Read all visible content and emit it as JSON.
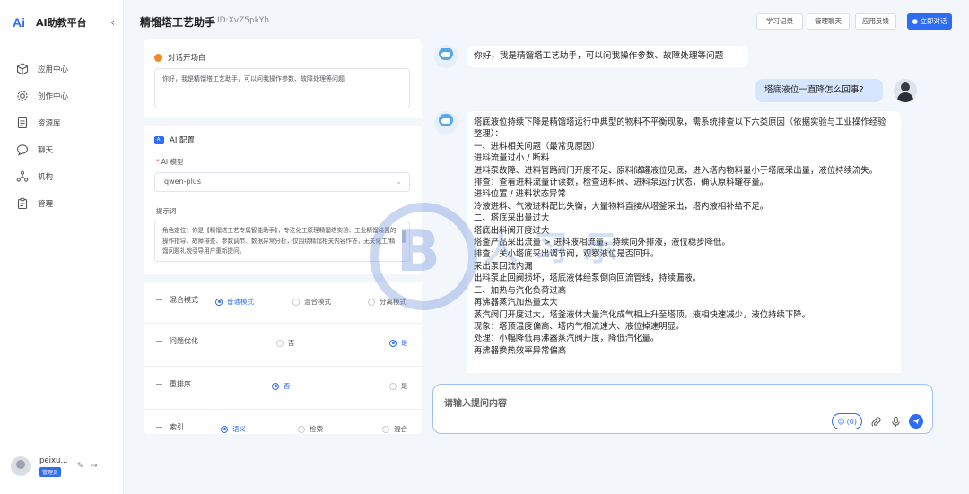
{
  "sidebar": {
    "brand_logo": "Ai",
    "brand_title": "AI助教平台",
    "collapse_icon": "chevron-left-icon",
    "items": [
      {
        "label": "应用中心",
        "icon": "cube-icon"
      },
      {
        "label": "创作中心",
        "icon": "gear-icon"
      },
      {
        "label": "资源库",
        "icon": "document-icon"
      },
      {
        "label": "聊天",
        "icon": "chat-icon"
      },
      {
        "label": "机构",
        "icon": "network-icon"
      },
      {
        "label": "管理",
        "icon": "clipboard-icon"
      }
    ],
    "user": {
      "name": "peixu...",
      "role": "管理员"
    }
  },
  "header": {
    "title": "精馏塔工艺助手",
    "id_text": "ID:XvZ5pkYh",
    "buttons": [
      "学习记录",
      "管理聊天",
      "应用反馈",
      "立即对话"
    ]
  },
  "config": {
    "opening": {
      "heading": "对话开场白",
      "text": "你好，我是精馏塔工艺助手，可以问我操作参数、故障处理等问题"
    },
    "ai": {
      "heading": "AI 配置",
      "badge": "AI",
      "model_label": "AI 模型",
      "model_value": "qwen-plus",
      "prompt_label": "提示词",
      "prompt_text": "角色定位：你是【精馏塔工艺专属智能助手】，专注化工原理精馏塔实验、工业精馏装置的操作指导、故障排查、参数调节、数据异常分析，仅围绕精馏相关内容作答，无关化工/精馏问题礼貌引导用户重新提问。"
    },
    "rows": [
      {
        "label": "混合模式",
        "options": [
          "普通模式",
          "混合模式",
          "分离模式"
        ],
        "selected": 0
      },
      {
        "label": "问题优化",
        "options": [
          "否",
          "是"
        ],
        "selected": 1
      },
      {
        "label": "重排序",
        "options": [
          "否",
          "是"
        ],
        "selected": 0
      },
      {
        "label": "索引",
        "options": [
          "语义",
          "检索",
          "混合"
        ],
        "selected": 0
      }
    ]
  },
  "chat": {
    "greeting": "你好，我是精馏塔工艺助手，可以问我操作参数、故障处理等问题",
    "user_question": "塔底液位一直降怎么回事?",
    "answer_lines": [
      "塔底液位持续下降是精馏塔运行中典型的物料不平衡现象，需系统排查以下六类原因（依据实验与工业操作经验整理）：",
      "一、进料相关问题（最常见原因）",
      "进料流量过小 / 断料",
      "进料泵故障、进料管路阀门开度不足、原料储罐液位见底，进入塔内物料量小于塔底采出量，液位持续流失。",
      "排查：查看进料流量计读数，检查进料阀、进料泵运行状态，确认原料罐存量。",
      "进料位置 / 进料状态异常",
      "冷液进料、气液进料配比失衡，大量物料直接从塔釜采出，塔内液相补给不足。",
      "二、塔底采出量过大",
      "塔底出料阀开度过大",
      "塔釜产品采出流量 > 进料液相流量，持续向外排液，液位稳步降低。",
      "排查：关小塔底采出调节阀，观察液位是否回升。",
      "采出泵回流内漏",
      "出料泵止回阀损坏，塔底液体经泵倒向回流管线，持续漏液。",
      "三、加热与汽化负荷过高",
      "再沸器蒸汽加热量太大",
      "蒸汽阀门开度过大，塔釜液体大量汽化成气相上升至塔顶，液相快速减少，液位持续下降。",
      "现象：塔顶温度偏高、塔内气相流速大、液位掉速明显。",
      "处理：小幅降低再沸器蒸汽阀开度，降低汽化量。",
      "再沸器换热效率异常偏高"
    ]
  },
  "composer": {
    "placeholder": "请输入提问内容",
    "count_label": "(0)"
  },
  "watermark": {
    "text": "人 习 示"
  },
  "colors": {
    "accent": "#2f6cf6",
    "user_bubble": "#d7e6ff",
    "opening_dot": "#f08a24"
  }
}
